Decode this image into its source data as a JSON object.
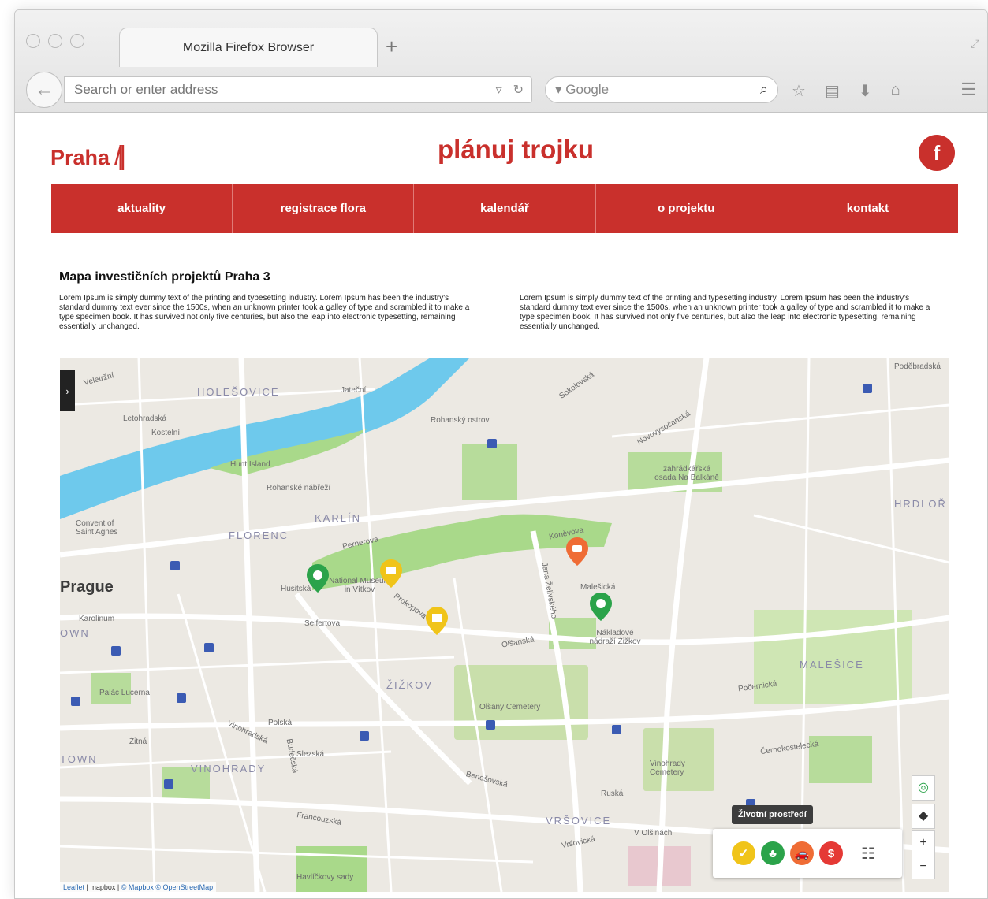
{
  "browser": {
    "tab_title": "Mozilla Firefox Browser",
    "new_tab": "+",
    "address_placeholder": "Search or enter address",
    "search_engine": "Google",
    "back_icon": "back-arrow-icon"
  },
  "site": {
    "logo_text": "Praha",
    "logo_bars": "/||",
    "tagline": "plánuj trojku",
    "facebook_label": "f",
    "nav": [
      "aktuality",
      "registrace flora",
      "kalendář",
      "o projektu",
      "kontakt"
    ]
  },
  "content": {
    "title": "Mapa investičních projektů Praha 3",
    "paragraph_left": "Lorem Ipsum is simply dummy text of the printing and typesetting industry. Lorem Ipsum has been the industry's standard dummy text ever since the 1500s, when an unknown printer took a galley of type and scrambled it to make a type specimen book. It has survived not only five centuries, but also the leap into electronic typesetting, remaining essentially unchanged.",
    "paragraph_right": "Lorem Ipsum is simply dummy text of the printing and typesetting industry. Lorem Ipsum has been the industry's standard dummy text ever since the 1500s, when an unknown printer took a galley of type and scrambled it to make a type specimen book. It has survived not only five centuries, but also the leap into electronic typesetting, remaining essentially unchanged."
  },
  "map": {
    "sidebar_toggle": "›",
    "districts": {
      "holesovice": "HOLEŠOVICE",
      "karlin": "KARLÍN",
      "florenc": "FLORENC",
      "zizkov": "ŽIŽKOV",
      "vinohrady": "VINOHRADY",
      "vrsovice": "VRŠOVICE",
      "malesice": "MALEŠICE",
      "hrdlorezy": "HRDLOŘ",
      "town": "TOWN",
      "own": "OWN"
    },
    "city": "Prague",
    "places": {
      "rohansky": "Rohanský ostrov",
      "hunt_island": "Hunt Island",
      "balkan": "zahrádkářská osada Na Balkáně",
      "convent": "Convent of Saint Agnes",
      "museum": "National Museum in Vítkov",
      "olsany": "Olšany Cemetery",
      "vinohrady_cem": "Vinohrady Cemetery",
      "nakladove": "Nákladové nádraží Žižkov",
      "havlickovy": "Havlíčkovy sady",
      "palac": "Palác Lucerna",
      "podebradska": "Poděbradská"
    },
    "streets": {
      "rohanske_nabrezi": "Rohanské nábřeží",
      "pernerova": "Pernerova",
      "husitska": "Husitská",
      "seifertova": "Seifertova",
      "prokopova": "Prokopova",
      "olsanska": "Olšanská",
      "konevova": "Koněvova",
      "malesicka": "Malešická",
      "jana_zelivskeho": "Jana Želivského",
      "vinohradska": "Vinohradská",
      "slezska": "Slezská",
      "francouzska": "Francouzská",
      "ruska": "Ruská",
      "bendikova": "Benešovská",
      "narodni": "Vršovická",
      "jatecni": "Jateční",
      "veletrzni": "Veletržní",
      "sokolovska": "Sokolovská",
      "novovysocanska": "Novovysočanská",
      "kostelni": "Kostelní",
      "letohradska": "Letohradská",
      "pocernicka": "Počernická",
      "cernokostelecka": "Černokostelecká",
      "zitna": "Žitná",
      "polska": "Polská",
      "krakovska": "Karolinum",
      "na_vrsich": "V Olšinách",
      "budecska": "Budečská"
    },
    "tooltip": "Životní prostředí",
    "controls": {
      "locate_icon": "locate-icon",
      "layers_icon": "layers-icon",
      "zoom_in": "+",
      "zoom_out": "−"
    },
    "filters": [
      {
        "name": "construction",
        "color": "#f0c419",
        "icon": "✓"
      },
      {
        "name": "environment",
        "color": "#2ba34a",
        "icon": "♣"
      },
      {
        "name": "transport",
        "color": "#ef6c35",
        "icon": "🚗"
      },
      {
        "name": "finance",
        "color": "#e53935",
        "icon": "$"
      }
    ],
    "filter_settings_icon": "sliders-icon",
    "attribution": {
      "leaflet": "Leaflet",
      "mapbox": "© Mapbox",
      "osm": "© OpenStreetMap",
      "sep": " | ",
      "mapbox_logo": "mapbox"
    },
    "colors": {
      "water": "#6ec9ec",
      "park": "#a9d98a",
      "road": "#ffffff",
      "land": "#ece9e3"
    }
  }
}
